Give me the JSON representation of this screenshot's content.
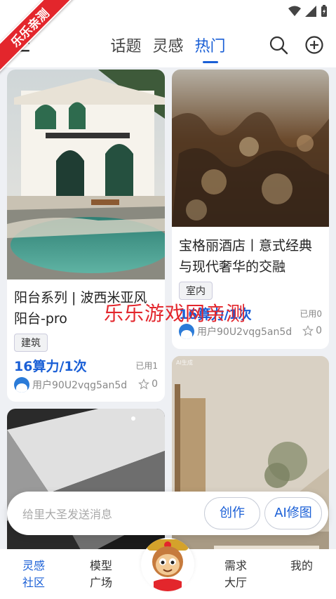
{
  "ribbon": "乐乐亲测",
  "watermark": "乐乐游戏网亲测",
  "tabs": [
    "话题",
    "灵感",
    "热门"
  ],
  "active_tab": "热门",
  "cards": [
    {
      "title": "阳台系列 | 波西米亚风阳台-pro",
      "tag": "建筑",
      "price": "16算力/1次",
      "used": "已用1",
      "user": "用户90U2vqg5an5d",
      "likes": "0"
    },
    {
      "title": "宝格丽酒店丨意式经典与现代奢华的交融",
      "tag": "室内",
      "price": "16算力/1次",
      "used": "已用0",
      "user": "用户90U2vqg5an5d",
      "likes": "0"
    },
    {
      "ai_mark": "AI生成"
    }
  ],
  "input": {
    "placeholder": "给里大圣发送消息",
    "create": "创作",
    "ai_edit": "AI修图"
  },
  "nav": [
    {
      "label": "灵感\n社区"
    },
    {
      "label": "模型\n广场"
    },
    {
      "label": "需求\n大厅"
    },
    {
      "label": "我的"
    }
  ],
  "colors": {
    "accent": "#1a5fd6",
    "ribbon": "#e3262c"
  }
}
